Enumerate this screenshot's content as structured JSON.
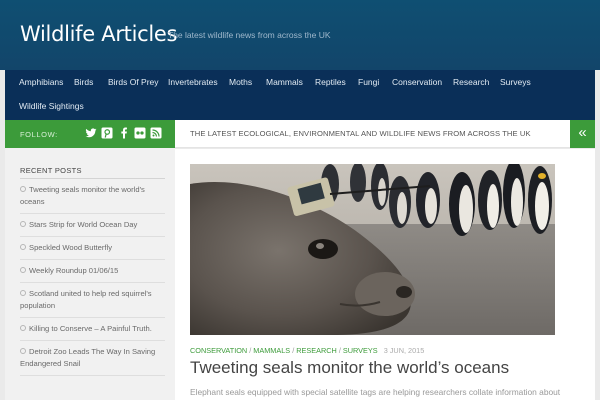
{
  "header": {
    "site_title": "Wildlife Articles",
    "tagline": "The latest wildlife news from across the UK"
  },
  "nav": {
    "items": [
      "Amphibians",
      "Birds",
      "Birds Of Prey",
      "Invertebrates",
      "Moths",
      "Mammals",
      "Reptiles",
      "Fungi",
      "Conservation",
      "Research",
      "Surveys",
      "Wildlife Sightings"
    ]
  },
  "follow": {
    "label": "FOLLOW:",
    "icons": [
      "twitter-icon",
      "pinterest-icon",
      "facebook-icon",
      "flickr-icon",
      "rss-icon"
    ]
  },
  "subheader": {
    "text": "THE LATEST ECOLOGICAL, ENVIRONMENTAL AND WILDLIFE NEWS FROM ACROSS THE UK",
    "toggle_glyph": "«"
  },
  "sidebar": {
    "recent_title": "RECENT POSTS",
    "posts": [
      "Tweeting seals monitor the world's oceans",
      "Stars Strip for World Ocean Day",
      "Speckled Wood Butterfly",
      "Weekly Roundup 01/06/15",
      "Scotland united to help red squirrel's population",
      "Killing to Conserve – A Painful Truth.",
      "Detroit Zoo Leads The Way In Saving Endangered Snail"
    ]
  },
  "article": {
    "categories": [
      "CONSERVATION",
      "MAMMALS",
      "RESEARCH",
      "SURVEYS"
    ],
    "category_separator": "/",
    "date": "3 JUN, 2015",
    "title": "Tweeting seals monitor the world’s oceans",
    "excerpt": "Elephant seals equipped with special satellite tags are helping researchers collate information about"
  },
  "colors": {
    "header_bg": "#0f4f72",
    "nav_bg": "#0a2f58",
    "accent_green": "#3c9b3a"
  }
}
